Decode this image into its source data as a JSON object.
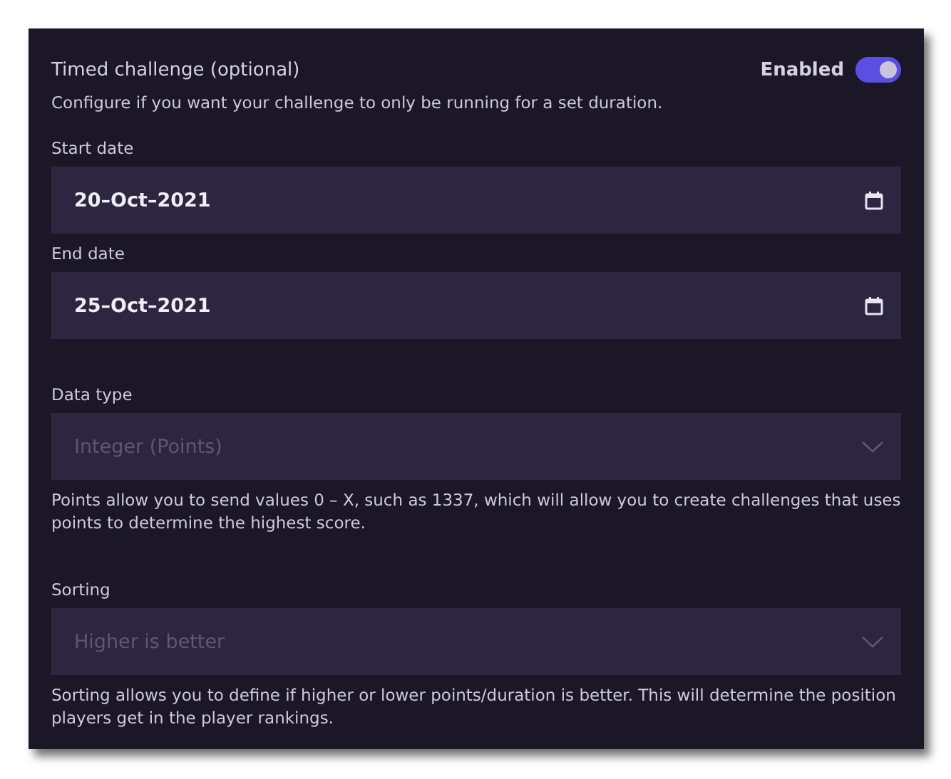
{
  "section": {
    "title": "Timed challenge (optional)",
    "toggle": {
      "label": "Enabled",
      "on": true
    },
    "description": "Configure if you want your challenge to only be running for a set duration."
  },
  "fields": [
    {
      "kind": "date",
      "label": "Start date",
      "value": "20–Oct–2021"
    },
    {
      "kind": "date",
      "label": "End date",
      "value": "25–Oct–2021"
    },
    {
      "kind": "select",
      "label": "Data type",
      "value": "Integer (Points)",
      "disabled": true,
      "help": "Points allow you to send values 0 – X, such as 1337, which will allow you to create challenges that uses points to determine the highest score."
    },
    {
      "kind": "select",
      "label": "Sorting",
      "value": "Higher is better",
      "disabled": true,
      "help": "Sorting allows you to define if higher or lower points/duration is better. This will determine the position players get in the player rankings."
    }
  ]
}
